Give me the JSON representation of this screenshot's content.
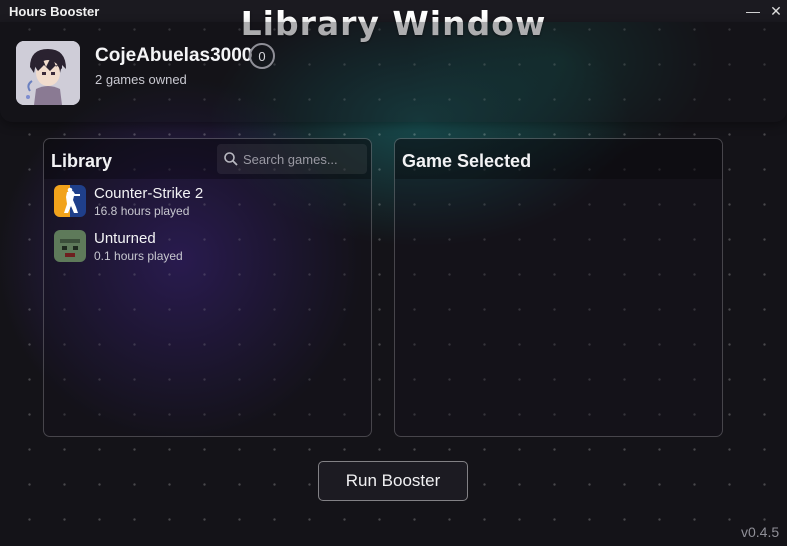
{
  "window": {
    "app_title": "Hours Booster",
    "window_label": "Library Window",
    "minimize_glyph": "—",
    "close_glyph": "✕"
  },
  "profile": {
    "username": "CojeAbuelas3000",
    "level": "0",
    "games_owned": "2 games owned"
  },
  "library": {
    "title": "Library",
    "search_placeholder": "Search games...",
    "games": [
      {
        "name": "Counter-Strike 2",
        "hours": "16.8 hours played",
        "icon": "counter-strike-2-icon"
      },
      {
        "name": "Unturned",
        "hours": "0.1 hours played",
        "icon": "unturned-icon"
      }
    ]
  },
  "selected": {
    "title": "Game Selected"
  },
  "actions": {
    "run_label": "Run Booster"
  },
  "footer": {
    "version": "v0.4.5"
  },
  "colors": {
    "background": "#141318",
    "accent_purple": "#46289a",
    "accent_teal": "#197878",
    "cs2_icon_orange": "#f2a31b",
    "cs2_icon_blue": "#1f3f8a",
    "unturned_green": "#5e7a5a"
  }
}
